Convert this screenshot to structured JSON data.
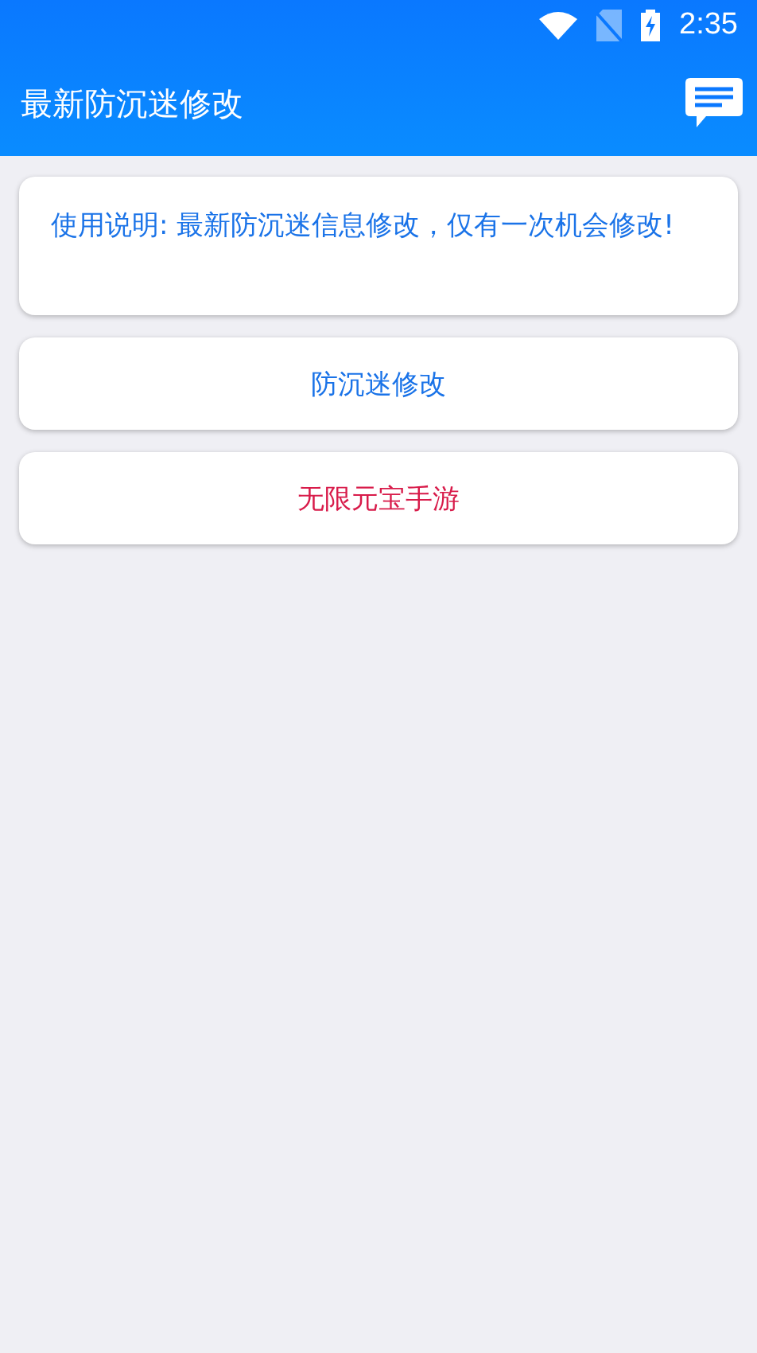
{
  "status_bar": {
    "time": "2:35"
  },
  "app_bar": {
    "title": "最新防沉迷修改"
  },
  "notice": {
    "text": "使用说明: 最新防沉迷信息修改，仅有一次机会修改!"
  },
  "actions": [
    {
      "label": "防沉迷修改",
      "color": "#1a73e8"
    },
    {
      "label": "无限元宝手游",
      "color": "#d81b4a"
    }
  ]
}
